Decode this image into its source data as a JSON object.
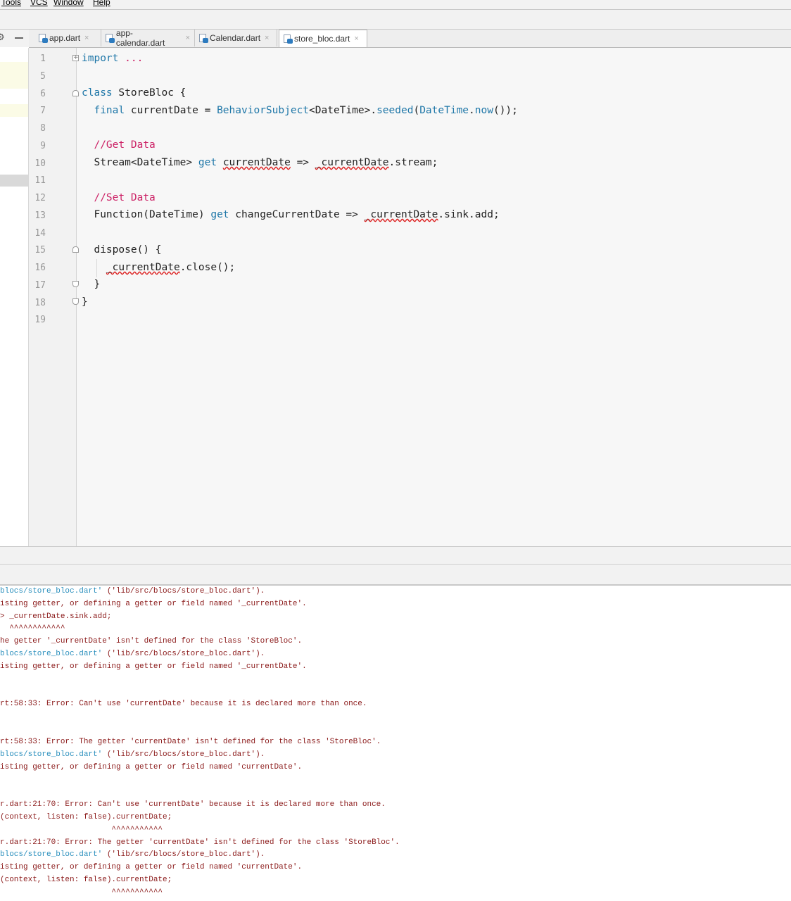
{
  "menu": [
    "Tools",
    "VCS",
    "Window",
    "Help"
  ],
  "tabs": [
    {
      "label": "app.dart",
      "active": false
    },
    {
      "label": "app-calendar.dart",
      "active": false
    },
    {
      "label": "Calendar.dart",
      "active": false
    },
    {
      "label": "store_bloc.dart",
      "active": true
    }
  ],
  "tab_close_glyph": "×",
  "editor": {
    "line_numbers": [
      "1",
      "5",
      "6",
      "7",
      "8",
      "9",
      "10",
      "11",
      "12",
      "13",
      "14",
      "15",
      "16",
      "17",
      "18",
      "19"
    ],
    "code": {
      "l1_kw": "import",
      "l1_rest": " ...",
      "l6_kw": "class",
      "l6_rest": " StoreBloc {",
      "l7_kw": "final",
      "l7_a": " currentDate = ",
      "l7_b": "BehaviorSubject",
      "l7_c": "<DateTime>.",
      "l7_d": "seeded",
      "l7_e": "(",
      "l7_f": "DateTime",
      "l7_g": ".",
      "l7_h": "now",
      "l7_i": "());",
      "l9_comment": "//Get Data",
      "l10_a": "Stream<DateTime> ",
      "l10_kw": "get",
      "l10_b": " ",
      "l10_err1": "currentDate",
      "l10_c": " => ",
      "l10_err2": "_currentDate",
      "l10_d": ".stream;",
      "l12_comment": "//Set Data",
      "l13_a": "Function(DateTime) ",
      "l13_kw": "get",
      "l13_b": " changeCurrentDate => ",
      "l13_err": "_currentDate",
      "l13_c": ".sink.add;",
      "l15": "dispose() {",
      "l16_err": "_currentDate",
      "l16_rest": ".close();",
      "l17": "}",
      "l18": "}"
    }
  },
  "console": {
    "lines": [
      {
        "link": "blocs/store_bloc.dart'",
        "text": " ('lib/src/blocs/store_bloc.dart')."
      },
      {
        "link": "",
        "text": "isting getter, or defining a getter or field named '_currentDate'."
      },
      {
        "link": "",
        "text": "> _currentDate.sink.add;"
      },
      {
        "link": "",
        "text": "  ^^^^^^^^^^^^"
      },
      {
        "link": "",
        "text": "he getter '_currentDate' isn't defined for the class 'StoreBloc'."
      },
      {
        "link": "blocs/store_bloc.dart'",
        "text": " ('lib/src/blocs/store_bloc.dart')."
      },
      {
        "link": "",
        "text": "isting getter, or defining a getter or field named '_currentDate'."
      },
      {
        "link": "",
        "text": "rt:58:33: Error: Can't use 'currentDate' because it is declared more than once."
      },
      {
        "link": "",
        "text": "rt:58:33: Error: The getter 'currentDate' isn't defined for the class 'StoreBloc'."
      },
      {
        "link": "blocs/store_bloc.dart'",
        "text": " ('lib/src/blocs/store_bloc.dart')."
      },
      {
        "link": "",
        "text": "isting getter, or defining a getter or field named 'currentDate'."
      },
      {
        "link": "",
        "text": "r.dart:21:70: Error: Can't use 'currentDate' because it is declared more than once."
      },
      {
        "link": "",
        "text": "(context, listen: false).currentDate;"
      },
      {
        "link": "",
        "text": "                        ^^^^^^^^^^^"
      },
      {
        "link": "",
        "text": "r.dart:21:70: Error: The getter 'currentDate' isn't defined for the class 'StoreBloc'."
      },
      {
        "link": "blocs/store_bloc.dart'",
        "text": " ('lib/src/blocs/store_bloc.dart')."
      },
      {
        "link": "",
        "text": "isting getter, or defining a getter or field named 'currentDate'."
      },
      {
        "link": "",
        "text": "(context, listen: false).currentDate;"
      },
      {
        "link": "",
        "text": "                        ^^^^^^^^^^^"
      }
    ]
  },
  "colors": {
    "keyword": "#1f77a8",
    "comment": "#cc2266",
    "console_text": "#8b1a1a",
    "console_link": "#2a8fbd",
    "error_underline": "#d22"
  },
  "icons": {
    "settings": "gear-icon",
    "hide": "minimize-icon",
    "dart_file": "dart-file-icon",
    "fold": "fold-marker-icon"
  }
}
